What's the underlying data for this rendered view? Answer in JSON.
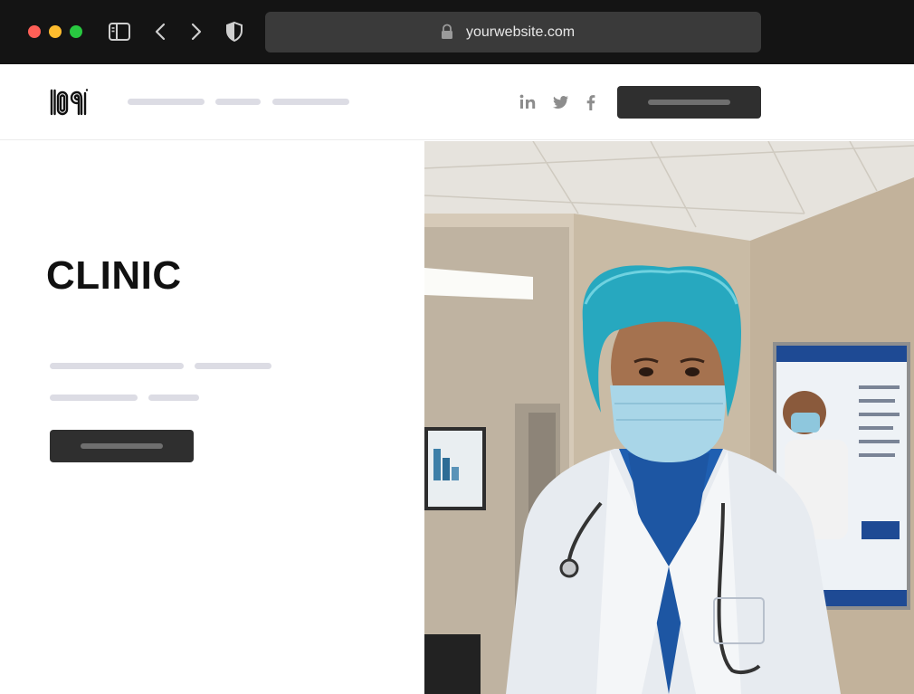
{
  "browser": {
    "url": "yourwebsite.com",
    "icons": [
      "sidebar-icon",
      "back-icon",
      "forward-icon",
      "shield-icon",
      "lock-icon"
    ]
  },
  "site": {
    "logo_icon": "logo-icon",
    "social_icons": [
      "linkedin-icon",
      "twitter-icon",
      "facebook-icon"
    ]
  },
  "hero": {
    "title": "CLINIC",
    "photo_icon": "doctor-photo"
  },
  "colors": {
    "chrome": "#141414",
    "urlbar": "#3a3a3a",
    "placeholder": "#dcdce4",
    "button": "#2f2f2f",
    "title": "#111111"
  }
}
